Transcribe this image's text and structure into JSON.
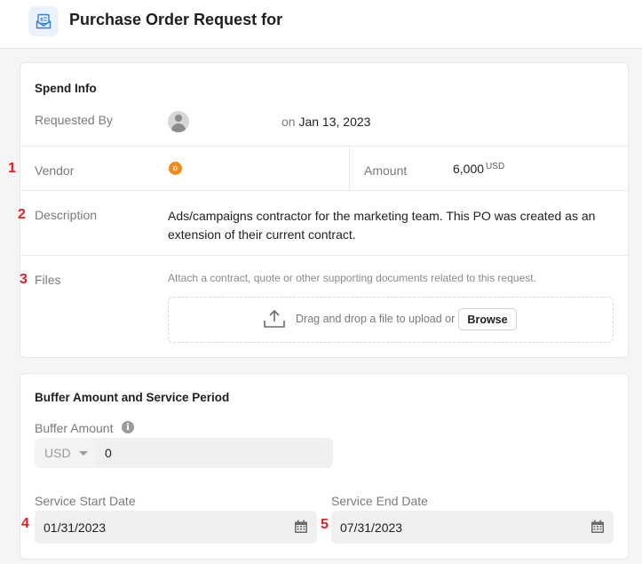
{
  "header": {
    "title": "Purchase Order Request for",
    "icon": "purchase-order-icon",
    "icon_color": "#2f7fd8"
  },
  "spend_info": {
    "title": "Spend Info",
    "requested_by": {
      "label": "Requested By",
      "on": "on",
      "date": "Jan 13, 2023",
      "avatar_icon": "user-avatar-icon"
    },
    "vendor": {
      "label": "Vendor",
      "badge_letter": "D",
      "badge_color": "#f08c1e"
    },
    "amount": {
      "label": "Amount",
      "value": "6,000",
      "currency": "USD"
    },
    "description": {
      "label": "Description",
      "value": "Ads/campaigns contractor for the marketing team. This PO was created as an extension of their current contract."
    },
    "files": {
      "label": "Files",
      "hint": "Attach a contract, quote or other supporting documents related to this request.",
      "drop_text": "Drag and drop a file to upload or",
      "browse_label": "Browse",
      "upload_icon": "upload-icon"
    }
  },
  "buffer": {
    "title": "Buffer Amount and Service Period",
    "buffer_amount": {
      "label": "Buffer Amount",
      "info_icon": "info-icon",
      "currency": "USD",
      "value": "0"
    },
    "service_start": {
      "label": "Service Start Date",
      "value": "01/31/2023",
      "icon": "calendar-icon"
    },
    "service_end": {
      "label": "Service End Date",
      "value": "07/31/2023",
      "icon": "calendar-icon"
    }
  },
  "markers": [
    "1",
    "2",
    "3",
    "4",
    "5"
  ],
  "colors": {
    "marker": "#e02020",
    "card_bg": "#ffffff",
    "page_bg": "#f5f5f5"
  }
}
